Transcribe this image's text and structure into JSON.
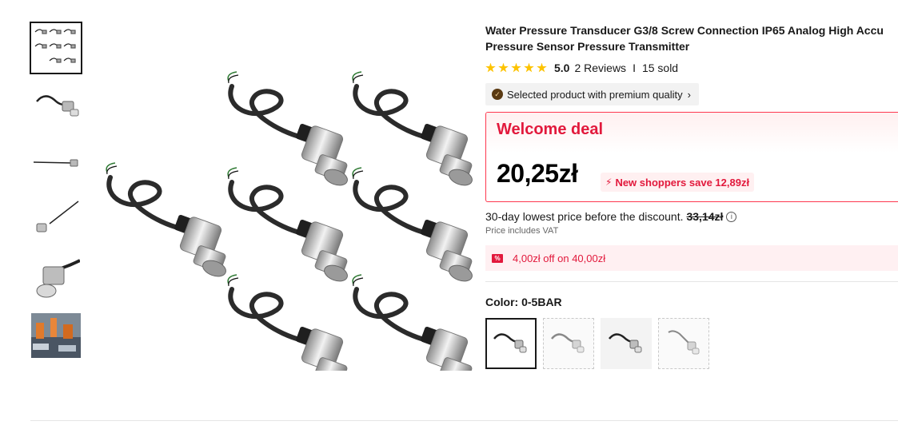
{
  "product": {
    "title_line1": "Water Pressure Transducer G3/8 Screw Connection IP65 Analog High Accu",
    "title_line2": "Pressure Sensor Pressure Transmitter",
    "rating_score": "5.0",
    "reviews": "2 Reviews",
    "separator": "I",
    "sold": "15 sold",
    "premium_label": "Selected product with premium quality"
  },
  "deal": {
    "title": "Welcome deal",
    "price": "20,25zł",
    "save_text": "New shoppers save 12,89zł"
  },
  "pricing": {
    "lowest_text": "30-day lowest price before the discount.",
    "lowest_price": "33,14zł",
    "vat": "Price includes VAT",
    "coupon": "4,00zł off on 40,00zł"
  },
  "variant": {
    "color_label": "Color: 0-5BAR",
    "options": [
      "0-5BAR",
      "option-2",
      "option-3",
      "option-4"
    ],
    "selected_index": 0
  },
  "colors": {
    "accent_red": "#e2193c",
    "star": "#fdc300",
    "text": "#191919"
  },
  "icons": {
    "star": "star-icon",
    "premium": "premium-badge-icon",
    "chevron": "chevron-right-icon",
    "bolt": "bolt-icon",
    "info": "info-icon",
    "coupon": "coupon-tag-icon"
  },
  "thumbnails": [
    "multi-pack",
    "single-sensor",
    "sensor-with-cable",
    "sensor-angled",
    "sensor-closeup",
    "factory-scene"
  ]
}
